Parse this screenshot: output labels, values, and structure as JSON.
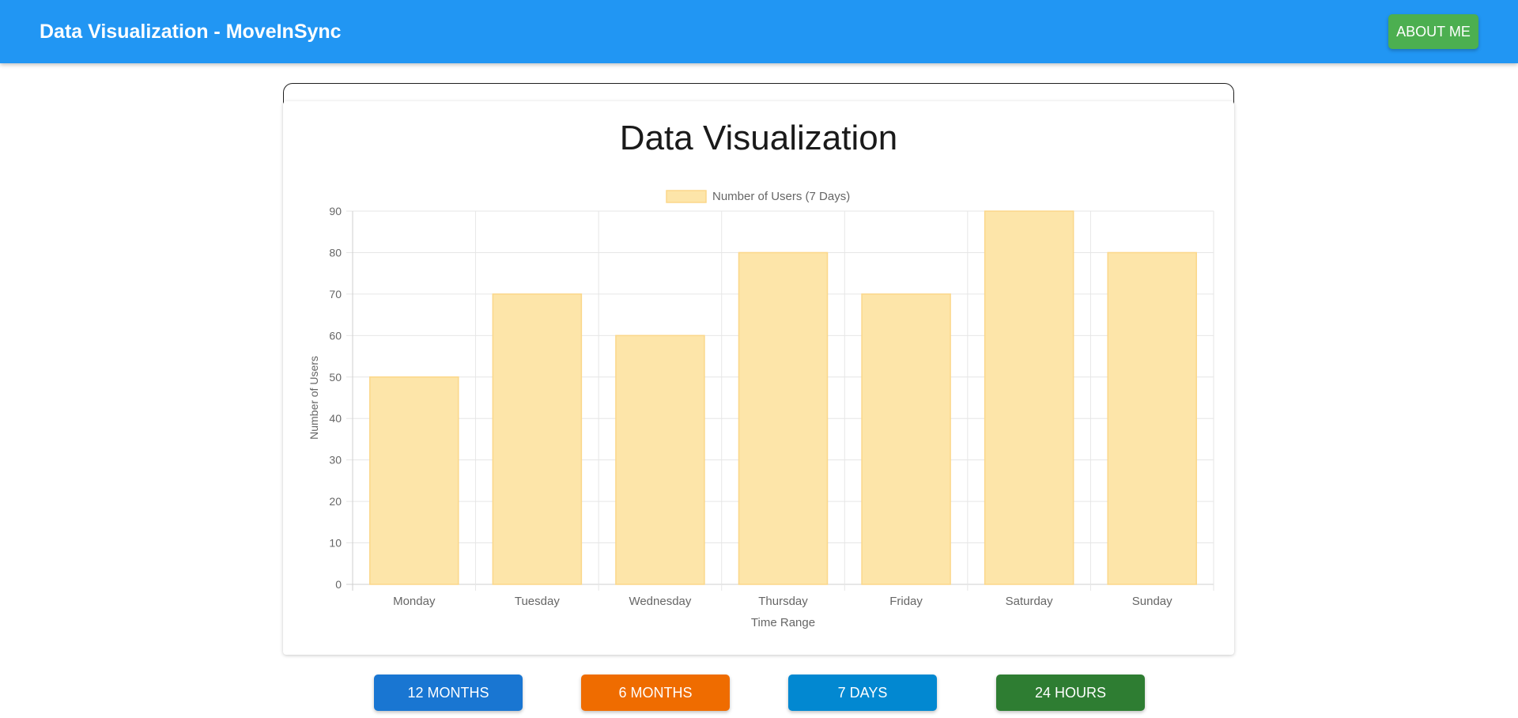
{
  "header": {
    "title": "Data Visualization - MoveInSync",
    "about_label": "ABOUT ME"
  },
  "chart_data": {
    "type": "bar",
    "title": "Data Visualization",
    "categories": [
      "Monday",
      "Tuesday",
      "Wednesday",
      "Thursday",
      "Friday",
      "Saturday",
      "Sunday"
    ],
    "series": [
      {
        "name": "Number of Users (7 Days)",
        "values": [
          50,
          70,
          60,
          80,
          70,
          90,
          80
        ]
      }
    ],
    "xlabel": "Time Range",
    "ylabel": "Number of Users",
    "ylim": [
      0,
      90
    ],
    "yticks": [
      0,
      10,
      20,
      30,
      40,
      50,
      60,
      70,
      80,
      90
    ],
    "grid": true,
    "legend": "top-center",
    "bar_fill": "#fde5a9",
    "bar_stroke": "#fbd78a"
  },
  "range_buttons": [
    {
      "label": "12 MONTHS",
      "color": "#1976d2",
      "name": "range-12-months-button"
    },
    {
      "label": "6 MONTHS",
      "color": "#ef6c00",
      "name": "range-6-months-button"
    },
    {
      "label": "7 DAYS",
      "color": "#0288d1",
      "name": "range-7-days-button"
    },
    {
      "label": "24 HOURS",
      "color": "#2e7d32",
      "name": "range-24-hours-button"
    }
  ],
  "colors": {
    "appbar": "#2196f3",
    "about_button": "#4caf50"
  }
}
